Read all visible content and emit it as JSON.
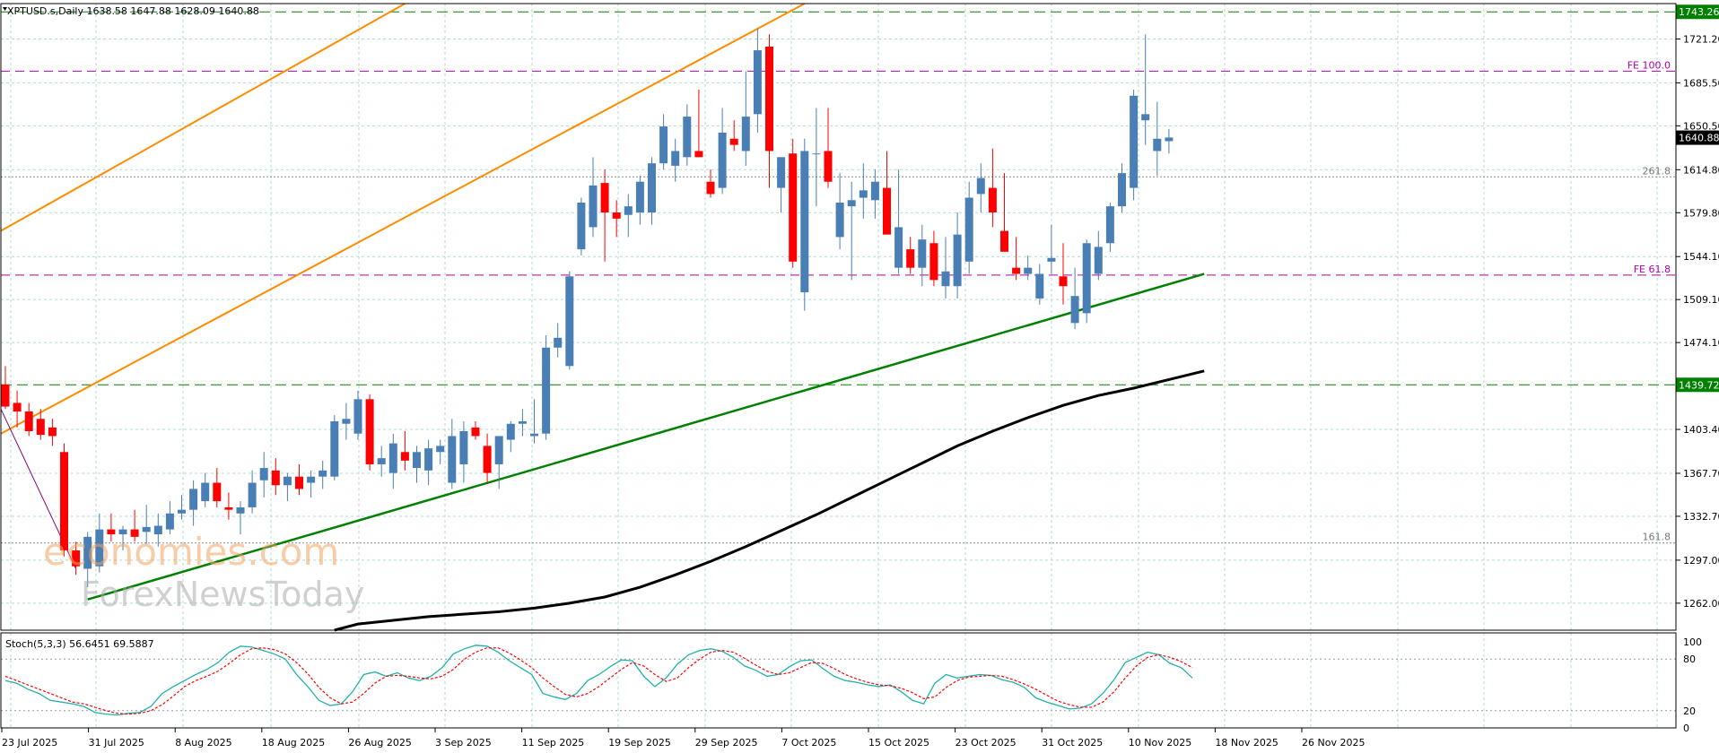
{
  "header": {
    "symbol_line": "XPTUSD.s,Daily  1638.58 1647.88 1628.09 1640.88",
    "stoch_line": "Stoch(5,3,3) 56.6451 69.5887"
  },
  "watermark": {
    "line1": "economies.com",
    "line2": "ForexNewsToday"
  },
  "colors": {
    "bull": "#4a7fb5",
    "bear": "#ff0000",
    "ma": "#000000",
    "channel": "#ff8c00",
    "trend": "#008000",
    "fe": "#aa00aa",
    "level_box": "#008000",
    "price_box": "#000000",
    "grid": "#b0dada",
    "stoch_main": "#20b2aa",
    "stoch_signal": "#ff0000"
  },
  "chart_data": {
    "type": "candlestick",
    "symbol": "XPTUSD.s",
    "timeframe": "Daily",
    "ylim": [
      1240,
      1750
    ],
    "y_ticks": [
      "1721.20",
      "1685.50",
      "1650.50",
      "1614.80",
      "1579.80",
      "1544.10",
      "1509.10",
      "1474.10",
      "1403.40",
      "1367.70",
      "1332.70",
      "1297.00",
      "1262.00"
    ],
    "x_ticks": [
      "23 Jul 2025",
      "31 Jul 2025",
      "8 Aug 2025",
      "18 Aug 2025",
      "26 Aug 2025",
      "3 Sep 2025",
      "11 Sep 2025",
      "19 Sep 2025",
      "29 Sep 2025",
      "7 Oct 2025",
      "15 Oct 2025",
      "23 Oct 2025",
      "31 Oct 2025",
      "10 Nov 2025",
      "18 Nov 2025",
      "26 Nov 2025"
    ],
    "horizontal_levels": [
      {
        "value": 1743.26,
        "label": "1743.26",
        "style": "dashed-green"
      },
      {
        "value": 1439.72,
        "label": "1439.72",
        "style": "dashed-green"
      },
      {
        "value": 1695.0,
        "label": "FE 100.0",
        "style": "dashed-purple"
      },
      {
        "value": 1529.0,
        "label": "FE 61.8",
        "style": "dashed-purple"
      },
      {
        "value": 1609.0,
        "label": "261.8",
        "style": "dotted-gray"
      },
      {
        "value": 1311.0,
        "label": "161.8",
        "style": "dotted-gray"
      }
    ],
    "current_price": "1640.88",
    "candles": [
      {
        "o": 1440,
        "h": 1455,
        "l": 1420,
        "c": 1422
      },
      {
        "o": 1425,
        "h": 1435,
        "l": 1405,
        "c": 1418
      },
      {
        "o": 1418,
        "h": 1425,
        "l": 1398,
        "c": 1402
      },
      {
        "o": 1412,
        "h": 1420,
        "l": 1395,
        "c": 1399
      },
      {
        "o": 1405,
        "h": 1412,
        "l": 1390,
        "c": 1398
      },
      {
        "o": 1385,
        "h": 1392,
        "l": 1300,
        "c": 1305
      },
      {
        "o": 1305,
        "h": 1312,
        "l": 1285,
        "c": 1292
      },
      {
        "o": 1290,
        "h": 1320,
        "l": 1275,
        "c": 1316
      },
      {
        "o": 1292,
        "h": 1335,
        "l": 1287,
        "c": 1322
      },
      {
        "o": 1322,
        "h": 1335,
        "l": 1312,
        "c": 1318
      },
      {
        "o": 1318,
        "h": 1325,
        "l": 1305,
        "c": 1322
      },
      {
        "o": 1322,
        "h": 1338,
        "l": 1312,
        "c": 1316
      },
      {
        "o": 1320,
        "h": 1342,
        "l": 1310,
        "c": 1324
      },
      {
        "o": 1318,
        "h": 1335,
        "l": 1308,
        "c": 1325
      },
      {
        "o": 1322,
        "h": 1345,
        "l": 1318,
        "c": 1335
      },
      {
        "o": 1335,
        "h": 1350,
        "l": 1330,
        "c": 1338
      },
      {
        "o": 1338,
        "h": 1362,
        "l": 1325,
        "c": 1355
      },
      {
        "o": 1345,
        "h": 1368,
        "l": 1340,
        "c": 1360
      },
      {
        "o": 1360,
        "h": 1372,
        "l": 1340,
        "c": 1345
      },
      {
        "o": 1340,
        "h": 1352,
        "l": 1330,
        "c": 1338
      },
      {
        "o": 1335,
        "h": 1345,
        "l": 1318,
        "c": 1340
      },
      {
        "o": 1340,
        "h": 1370,
        "l": 1335,
        "c": 1360
      },
      {
        "o": 1362,
        "h": 1385,
        "l": 1348,
        "c": 1372
      },
      {
        "o": 1370,
        "h": 1380,
        "l": 1350,
        "c": 1358
      },
      {
        "o": 1358,
        "h": 1368,
        "l": 1345,
        "c": 1365
      },
      {
        "o": 1365,
        "h": 1375,
        "l": 1350,
        "c": 1355
      },
      {
        "o": 1360,
        "h": 1370,
        "l": 1348,
        "c": 1365
      },
      {
        "o": 1365,
        "h": 1378,
        "l": 1355,
        "c": 1370
      },
      {
        "o": 1365,
        "h": 1415,
        "l": 1362,
        "c": 1410
      },
      {
        "o": 1408,
        "h": 1425,
        "l": 1395,
        "c": 1412
      },
      {
        "o": 1400,
        "h": 1435,
        "l": 1395,
        "c": 1428
      },
      {
        "o": 1428,
        "h": 1432,
        "l": 1370,
        "c": 1375
      },
      {
        "o": 1375,
        "h": 1390,
        "l": 1365,
        "c": 1380
      },
      {
        "o": 1368,
        "h": 1400,
        "l": 1355,
        "c": 1392
      },
      {
        "o": 1385,
        "h": 1402,
        "l": 1370,
        "c": 1378
      },
      {
        "o": 1372,
        "h": 1390,
        "l": 1360,
        "c": 1385
      },
      {
        "o": 1370,
        "h": 1395,
        "l": 1358,
        "c": 1388
      },
      {
        "o": 1385,
        "h": 1395,
        "l": 1375,
        "c": 1390
      },
      {
        "o": 1360,
        "h": 1412,
        "l": 1355,
        "c": 1398
      },
      {
        "o": 1375,
        "h": 1410,
        "l": 1360,
        "c": 1402
      },
      {
        "o": 1405,
        "h": 1410,
        "l": 1395,
        "c": 1398
      },
      {
        "o": 1390,
        "h": 1400,
        "l": 1360,
        "c": 1368
      },
      {
        "o": 1375,
        "h": 1395,
        "l": 1355,
        "c": 1398
      },
      {
        "o": 1395,
        "h": 1410,
        "l": 1385,
        "c": 1408
      },
      {
        "o": 1408,
        "h": 1420,
        "l": 1398,
        "c": 1410
      },
      {
        "o": 1398,
        "h": 1428,
        "l": 1392,
        "c": 1400
      },
      {
        "o": 1400,
        "h": 1480,
        "l": 1395,
        "c": 1470
      },
      {
        "o": 1470,
        "h": 1490,
        "l": 1462,
        "c": 1478
      },
      {
        "o": 1455,
        "h": 1532,
        "l": 1452,
        "c": 1528
      },
      {
        "o": 1550,
        "h": 1592,
        "l": 1545,
        "c": 1588
      },
      {
        "o": 1568,
        "h": 1625,
        "l": 1560,
        "c": 1602
      },
      {
        "o": 1604,
        "h": 1615,
        "l": 1540,
        "c": 1580
      },
      {
        "o": 1580,
        "h": 1590,
        "l": 1560,
        "c": 1575
      },
      {
        "o": 1578,
        "h": 1595,
        "l": 1560,
        "c": 1585
      },
      {
        "o": 1580,
        "h": 1610,
        "l": 1570,
        "c": 1605
      },
      {
        "o": 1580,
        "h": 1625,
        "l": 1570,
        "c": 1620
      },
      {
        "o": 1620,
        "h": 1660,
        "l": 1615,
        "c": 1650
      },
      {
        "o": 1618,
        "h": 1640,
        "l": 1605,
        "c": 1630
      },
      {
        "o": 1625,
        "h": 1668,
        "l": 1618,
        "c": 1658
      },
      {
        "o": 1630,
        "h": 1680,
        "l": 1625,
        "c": 1625
      },
      {
        "o": 1605,
        "h": 1615,
        "l": 1592,
        "c": 1595
      },
      {
        "o": 1600,
        "h": 1665,
        "l": 1595,
        "c": 1645
      },
      {
        "o": 1640,
        "h": 1655,
        "l": 1630,
        "c": 1635
      },
      {
        "o": 1630,
        "h": 1695,
        "l": 1618,
        "c": 1658
      },
      {
        "o": 1660,
        "h": 1730,
        "l": 1645,
        "c": 1712
      },
      {
        "o": 1715,
        "h": 1725,
        "l": 1600,
        "c": 1630
      },
      {
        "o": 1600,
        "h": 1625,
        "l": 1580,
        "c": 1625
      },
      {
        "o": 1628,
        "h": 1640,
        "l": 1535,
        "c": 1540
      },
      {
        "o": 1515,
        "h": 1640,
        "l": 1500,
        "c": 1630
      },
      {
        "o": 1628,
        "h": 1665,
        "l": 1585,
        "c": 1628
      },
      {
        "o": 1630,
        "h": 1665,
        "l": 1600,
        "c": 1605
      },
      {
        "o": 1560,
        "h": 1612,
        "l": 1550,
        "c": 1588
      },
      {
        "o": 1585,
        "h": 1605,
        "l": 1525,
        "c": 1590
      },
      {
        "o": 1592,
        "h": 1620,
        "l": 1575,
        "c": 1598
      },
      {
        "o": 1590,
        "h": 1615,
        "l": 1575,
        "c": 1605
      },
      {
        "o": 1600,
        "h": 1630,
        "l": 1580,
        "c": 1562
      },
      {
        "o": 1535,
        "h": 1615,
        "l": 1530,
        "c": 1568
      },
      {
        "o": 1550,
        "h": 1560,
        "l": 1530,
        "c": 1535
      },
      {
        "o": 1535,
        "h": 1570,
        "l": 1520,
        "c": 1558
      },
      {
        "o": 1555,
        "h": 1565,
        "l": 1520,
        "c": 1525
      },
      {
        "o": 1520,
        "h": 1560,
        "l": 1510,
        "c": 1532
      },
      {
        "o": 1520,
        "h": 1580,
        "l": 1510,
        "c": 1562
      },
      {
        "o": 1540,
        "h": 1605,
        "l": 1530,
        "c": 1592
      },
      {
        "o": 1595,
        "h": 1620,
        "l": 1580,
        "c": 1608
      },
      {
        "o": 1600,
        "h": 1632,
        "l": 1568,
        "c": 1580
      },
      {
        "o": 1565,
        "h": 1612,
        "l": 1555,
        "c": 1548
      },
      {
        "o": 1535,
        "h": 1560,
        "l": 1525,
        "c": 1530
      },
      {
        "o": 1530,
        "h": 1545,
        "l": 1525,
        "c": 1535
      },
      {
        "o": 1510,
        "h": 1538,
        "l": 1505,
        "c": 1530
      },
      {
        "o": 1540,
        "h": 1570,
        "l": 1530,
        "c": 1543
      },
      {
        "o": 1528,
        "h": 1555,
        "l": 1505,
        "c": 1520
      },
      {
        "o": 1490,
        "h": 1535,
        "l": 1485,
        "c": 1512
      },
      {
        "o": 1498,
        "h": 1558,
        "l": 1490,
        "c": 1555
      },
      {
        "o": 1530,
        "h": 1565,
        "l": 1525,
        "c": 1552
      },
      {
        "o": 1555,
        "h": 1588,
        "l": 1548,
        "c": 1585
      },
      {
        "o": 1585,
        "h": 1620,
        "l": 1580,
        "c": 1612
      },
      {
        "o": 1600,
        "h": 1680,
        "l": 1590,
        "c": 1675
      },
      {
        "o": 1655,
        "h": 1725,
        "l": 1635,
        "c": 1660
      },
      {
        "o": 1630,
        "h": 1670,
        "l": 1610,
        "c": 1640
      },
      {
        "o": 1638,
        "h": 1648,
        "l": 1628,
        "c": 1641
      }
    ],
    "moving_average": [
      [
        28,
        1240
      ],
      [
        30,
        1245
      ],
      [
        33,
        1248
      ],
      [
        36,
        1251
      ],
      [
        39,
        1253
      ],
      [
        42,
        1255
      ],
      [
        45,
        1258
      ],
      [
        48,
        1262
      ],
      [
        51,
        1267
      ],
      [
        54,
        1275
      ],
      [
        57,
        1285
      ],
      [
        60,
        1296
      ],
      [
        63,
        1308
      ],
      [
        66,
        1321
      ],
      [
        69,
        1334
      ],
      [
        72,
        1348
      ],
      [
        75,
        1362
      ],
      [
        78,
        1376
      ],
      [
        81,
        1390
      ],
      [
        84,
        1402
      ],
      [
        87,
        1413
      ],
      [
        90,
        1423
      ],
      [
        93,
        1431
      ],
      [
        96,
        1437
      ],
      [
        99,
        1444
      ],
      [
        102,
        1451
      ]
    ],
    "stoch_main": [
      55,
      52,
      45,
      40,
      32,
      30,
      28,
      25,
      18,
      16,
      15,
      17,
      18,
      25,
      40,
      48,
      55,
      62,
      68,
      76,
      88,
      95,
      94,
      90,
      86,
      80,
      62,
      48,
      32,
      26,
      28,
      42,
      62,
      65,
      60,
      64,
      58,
      55,
      60,
      70,
      86,
      92,
      96,
      95,
      88,
      78,
      70,
      62,
      40,
      36,
      33,
      40,
      55,
      62,
      71,
      79,
      78,
      60,
      48,
      58,
      74,
      85,
      90,
      92,
      89,
      82,
      72,
      67,
      60,
      62,
      71,
      78,
      79,
      69,
      60,
      55,
      53,
      50,
      48,
      50,
      42,
      32,
      28,
      52,
      62,
      58,
      60,
      62,
      61,
      56,
      53,
      47,
      35,
      30,
      26,
      22,
      23,
      28,
      40,
      56,
      76,
      82,
      88,
      85,
      75,
      70,
      58
    ],
    "stoch_signal": [
      60,
      55,
      50,
      45,
      40,
      35,
      30,
      28,
      24,
      20,
      17,
      16,
      17,
      20,
      27,
      37,
      48,
      55,
      60,
      66,
      75,
      85,
      92,
      93,
      91,
      86,
      76,
      63,
      47,
      35,
      28,
      30,
      40,
      52,
      60,
      61,
      60,
      58,
      57,
      60,
      68,
      80,
      88,
      93,
      93,
      87,
      79,
      70,
      58,
      48,
      39,
      36,
      40,
      48,
      58,
      68,
      76,
      72,
      62,
      54,
      58,
      70,
      80,
      88,
      90,
      88,
      81,
      73,
      66,
      62,
      64,
      70,
      76,
      75,
      69,
      62,
      57,
      53,
      50,
      49,
      46,
      41,
      34,
      36,
      47,
      55,
      59,
      60,
      61,
      60,
      56,
      51,
      45,
      38,
      31,
      27,
      24,
      24,
      30,
      42,
      58,
      72,
      82,
      85,
      82,
      77,
      70
    ],
    "stoch_levels": [
      "100",
      "80",
      "20",
      "0"
    ]
  }
}
